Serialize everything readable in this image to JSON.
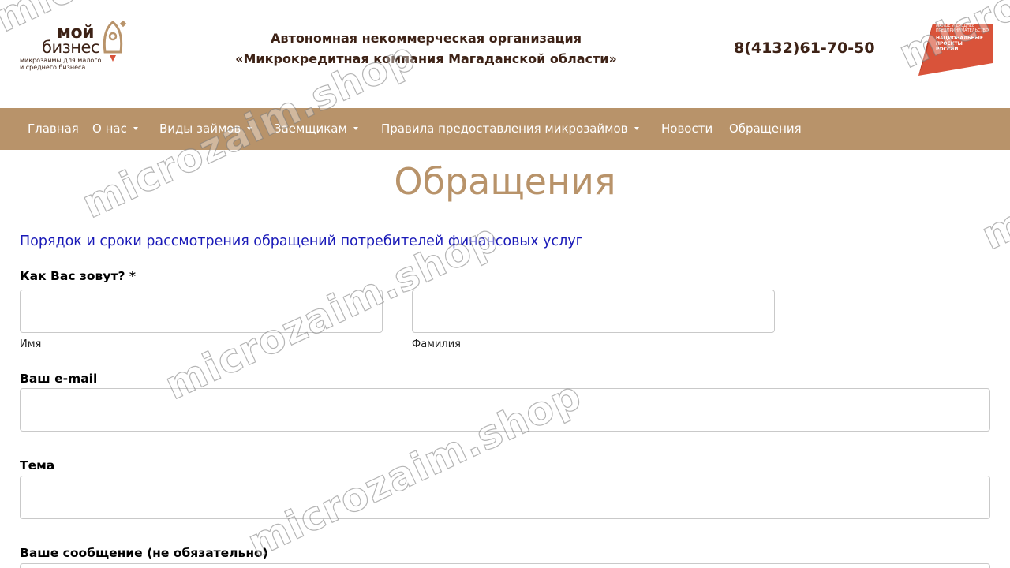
{
  "header": {
    "logo_line1": "мой",
    "logo_line2": "бизнес",
    "logo_line3": "микрозаймы для малого и среднего бизнеса",
    "org_line1": "Автономная некоммерческая организация",
    "org_line2": "«Микрокредитная компания Магаданской области»",
    "phone": "8(4132)61-70-50",
    "np_logo_line1": "МАЛОЕ И СРЕДНЕЕ ПРЕДПРИНИМАТЕЛЬСТВО",
    "np_logo_line2": "НАЦИОНАЛЬНЫЕ ПРОЕКТЫ РОССИИ"
  },
  "nav": {
    "items": [
      {
        "label": "Главная",
        "dropdown": false
      },
      {
        "label": "О нас",
        "dropdown": true
      },
      {
        "label": "Виды займов",
        "dropdown": true
      },
      {
        "label": "Заемщикам",
        "dropdown": true
      },
      {
        "label": "Правила предоставления микрозаймов",
        "dropdown": true
      },
      {
        "label": "Новости",
        "dropdown": false
      },
      {
        "label": "Обращения",
        "dropdown": false
      }
    ]
  },
  "main": {
    "title": "Обращения",
    "link": "Порядок и сроки рассмотрения обращений потребителей финансовых услуг",
    "form": {
      "name_label": "Как Вас зовут? *",
      "first_name_value": "",
      "first_name_sublabel": "Имя",
      "last_name_value": "",
      "last_name_sublabel": "Фамилия",
      "email_label": "Ваш e-mail",
      "email_value": "",
      "subject_label": "Тема",
      "subject_value": "",
      "message_label": "Ваше сообщение (не обязательно)"
    }
  },
  "watermark": "microzaim.shop",
  "colors": {
    "brand_dark": "#3d2216",
    "nav_bg": "#b8936a",
    "link": "#1a1ab8",
    "logo_accent": "#d9533a"
  }
}
